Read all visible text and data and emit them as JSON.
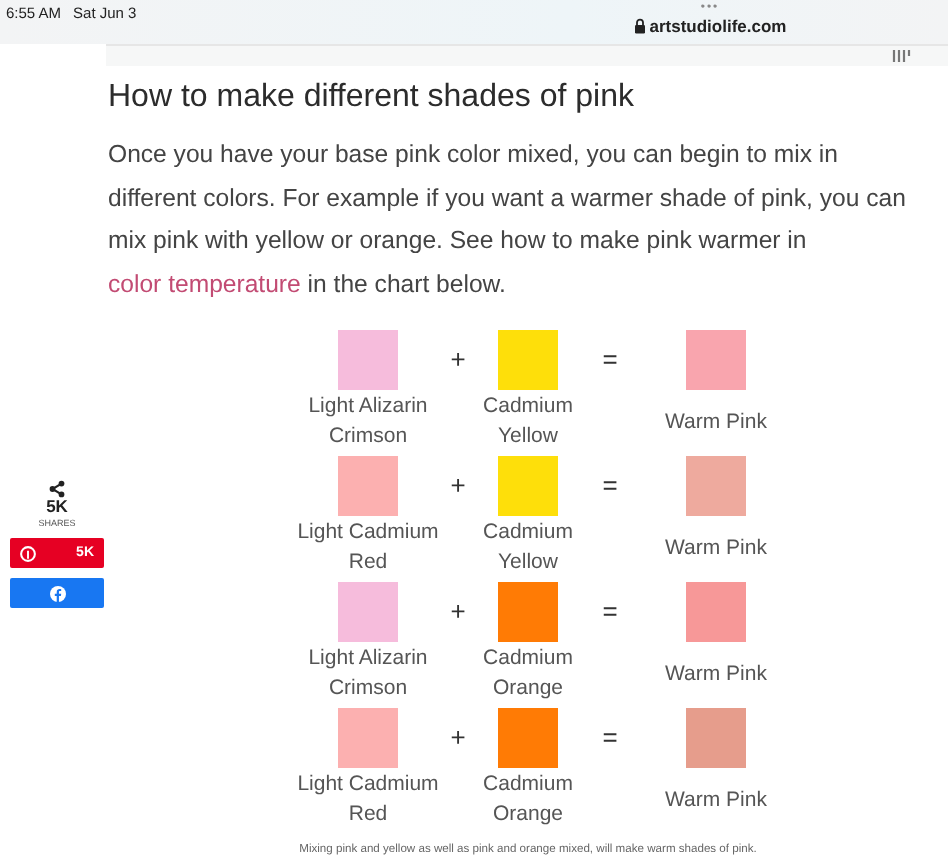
{
  "status_bar": {
    "time": "6:55 AM",
    "date": "Sat Jun 3"
  },
  "browser": {
    "dots": "•••",
    "url": "artstudiolife.com"
  },
  "article": {
    "heading": "How to make different shades of pink",
    "paragraph": "Once you have your base pink color mixed, you can begin to mix in different colors. For example if you want a warmer shade of pink, you can mix pink with yellow or orange. See how to make pink warmer in ",
    "link": "color temperature",
    "paragraph_end": " in the chart below."
  },
  "mix_chart": {
    "rows": [
      {
        "first": {
          "name": "Light Alizarin Crimson",
          "color": "#f6bcdc"
        },
        "plus": "+",
        "second": {
          "name": "Cadmium Yellow",
          "color": "#fedf0a"
        },
        "equals": "=",
        "result": {
          "name": "Warm Pink",
          "color": "#f9a5ae"
        }
      },
      {
        "first": {
          "name": "Light Cadmium Red",
          "color": "#fcb0b0"
        },
        "plus": "+",
        "second": {
          "name": "Cadmium Yellow",
          "color": "#fedf0a"
        },
        "equals": "=",
        "result": {
          "name": "Warm Pink",
          "color": "#eeaa9e"
        }
      },
      {
        "first": {
          "name": "Light Alizarin Crimson",
          "color": "#f6bcdc"
        },
        "plus": "+",
        "second": {
          "name": "Cadmium Orange",
          "color": "#ff7b05"
        },
        "equals": "=",
        "result": {
          "name": "Warm Pink",
          "color": "#f79898"
        }
      },
      {
        "first": {
          "name": "Light Cadmium Red",
          "color": "#fcb0b0"
        },
        "plus": "+",
        "second": {
          "name": "Cadmium Orange",
          "color": "#ff7b05"
        },
        "equals": "=",
        "result": {
          "name": "Warm Pink",
          "color": "#e69d8c"
        }
      }
    ],
    "caption": "Mixing pink and yellow as well as pink and orange mixed, will make warm shades of pink."
  },
  "share": {
    "count": "5K",
    "label": "SHARES",
    "pinterest_count": "5K"
  }
}
